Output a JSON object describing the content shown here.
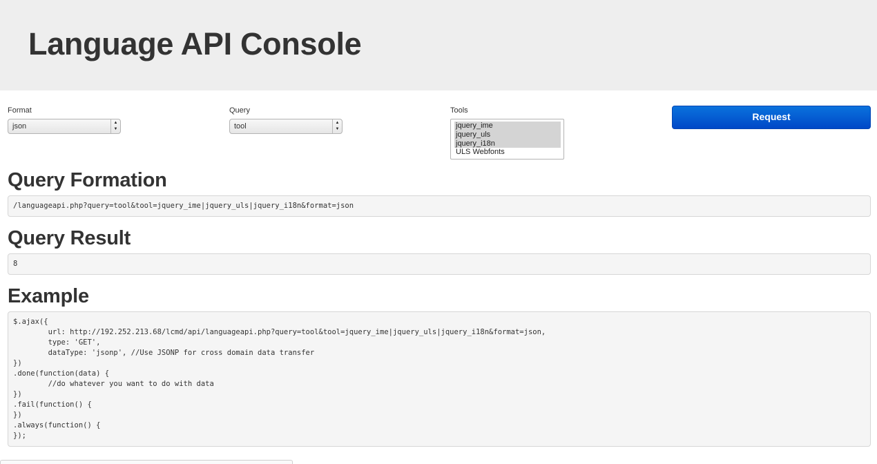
{
  "header": {
    "title": "Language API Console"
  },
  "form": {
    "format": {
      "label": "Format",
      "value": "json"
    },
    "query": {
      "label": "Query",
      "value": "tool"
    },
    "tools": {
      "label": "Tools",
      "options": [
        {
          "label": "jquery_ime",
          "selected": true
        },
        {
          "label": "jquery_uls",
          "selected": true
        },
        {
          "label": "jquery_i18n",
          "selected": true
        },
        {
          "label": "ULS Webfonts",
          "selected": false
        }
      ]
    },
    "request_label": "Request"
  },
  "query_formation": {
    "heading": "Query Formation",
    "value": "/languageapi.php?query=tool&tool=jquery_ime|jquery_uls|jquery_i18n&format=json"
  },
  "query_result": {
    "heading": "Query Result",
    "value": "8"
  },
  "example": {
    "heading": "Example",
    "code_lines": [
      "$.ajax({",
      "        url: http://192.252.213.68/lcmd/api/languageapi.php?query=tool&tool=jquery_ime|jquery_uls|jquery_i18n&format=json,",
      "        type: 'GET',",
      "        dataType: 'jsonp', //Use JSONP for cross domain data transfer",
      "})",
      ".done(function(data) {",
      "        //do whatever you want to do with data",
      "})",
      ".fail(function() {",
      "})",
      ".always(function() {",
      "});"
    ]
  },
  "colors": {
    "hero_background": "#eeeeee",
    "primary_button": "#0058d0",
    "code_background": "#f5f5f5",
    "selected_option": "#d4d4d4"
  },
  "icons": {
    "select_arrows": "up-down-chevron-icon"
  }
}
